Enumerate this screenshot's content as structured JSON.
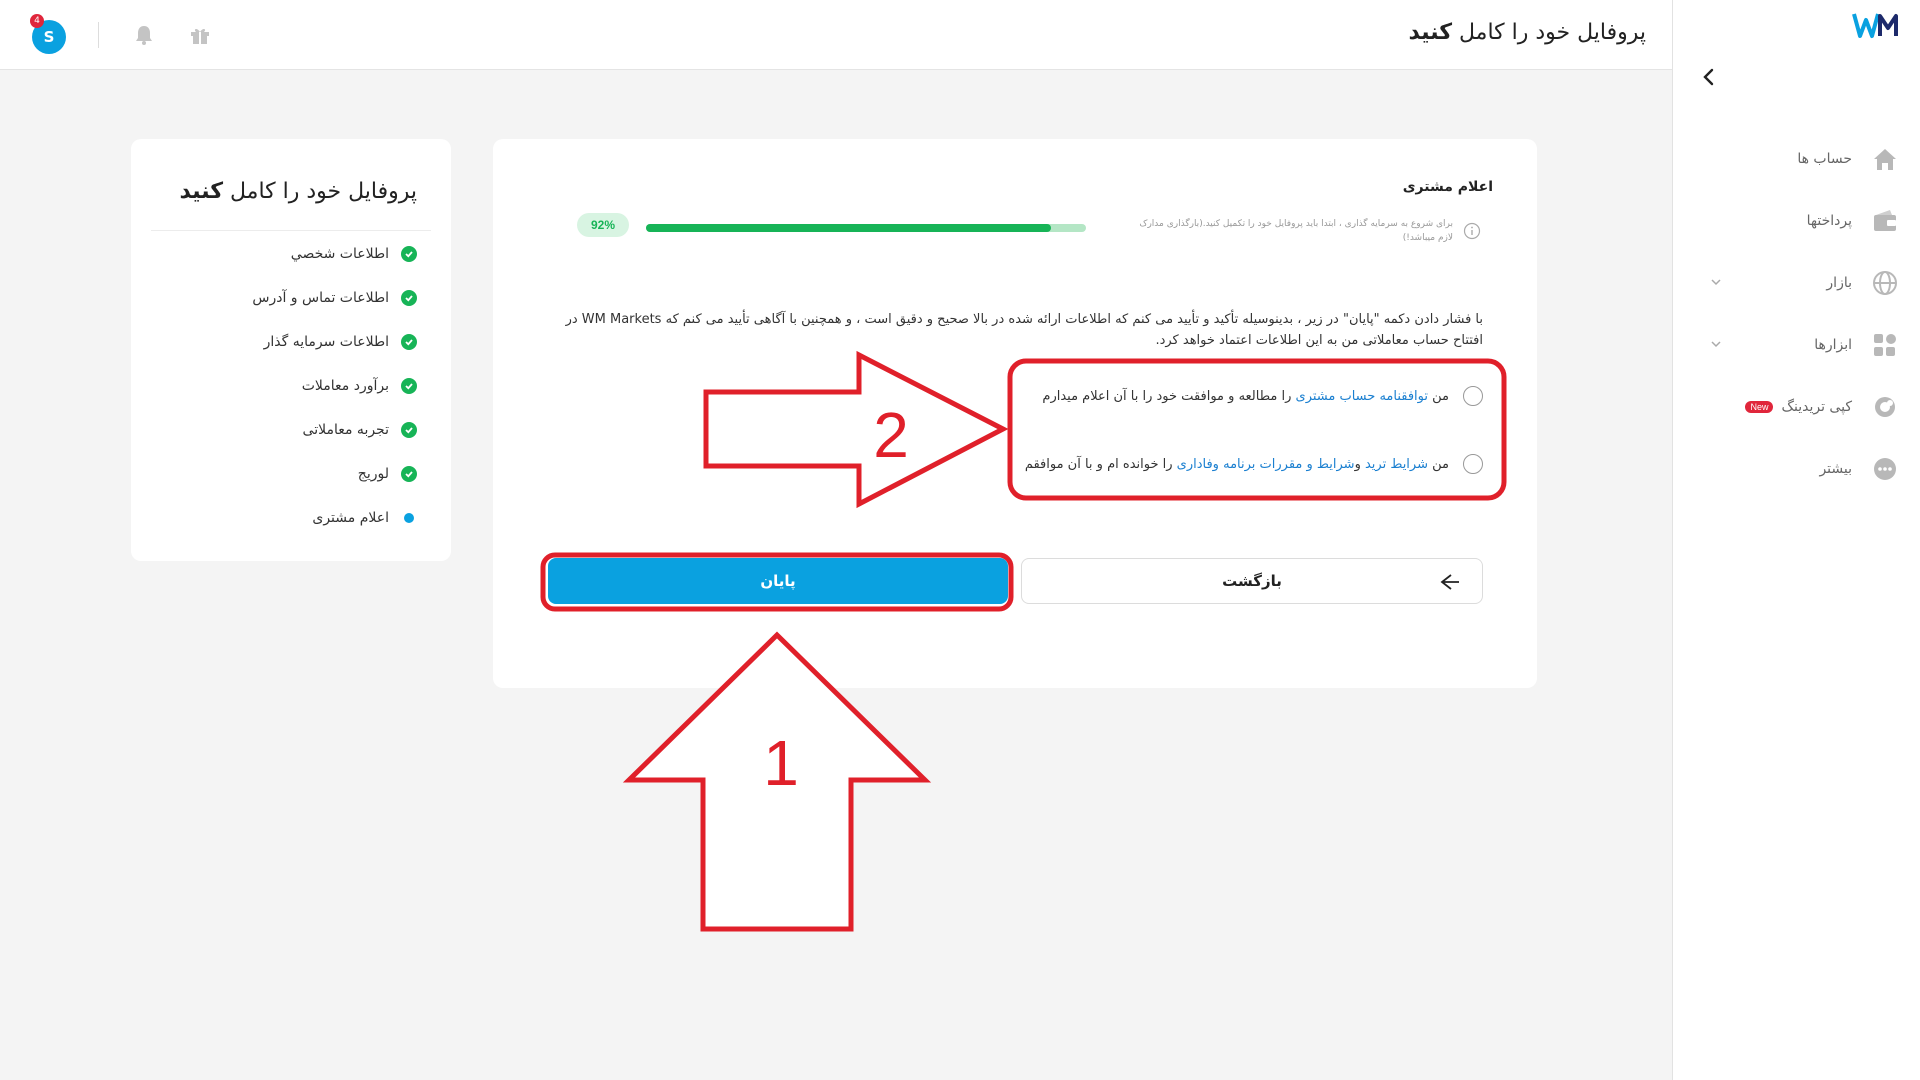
{
  "header": {
    "title_regular": "پروفایل خود را کامل ",
    "title_bold": "کنید",
    "avatar_letter": "S",
    "notification_count": "4"
  },
  "sidebar": {
    "items": [
      {
        "label": "حساب ها",
        "icon": "home-icon"
      },
      {
        "label": "پرداختها",
        "icon": "wallet-icon"
      },
      {
        "label": "بازار",
        "icon": "globe-icon"
      },
      {
        "label": "ابزارها",
        "icon": "tools-icon"
      },
      {
        "label": "کپی تریدینگ",
        "icon": "copy-trading-icon",
        "badge": "New"
      },
      {
        "label": "بیشتر",
        "icon": "more-icon"
      }
    ]
  },
  "steps": {
    "title_regular": "پروفایل خود را کامل ",
    "title_bold": "کنید",
    "items": [
      {
        "label": "اطلاعات شخصي",
        "status": "done"
      },
      {
        "label": "اطلاعات تماس و آدرس",
        "status": "done"
      },
      {
        "label": "اطلاعات سرمایه گذار",
        "status": "done"
      },
      {
        "label": "برآورد معاملات",
        "status": "done"
      },
      {
        "label": "تجربه معاملاتی",
        "status": "done"
      },
      {
        "label": "لوریج",
        "status": "done"
      },
      {
        "label": "اعلام مشتری",
        "status": "current"
      }
    ]
  },
  "main": {
    "section_title": "اعلام مشتری",
    "info_text": "برای شروع به سرمایه گذاری ، ابتدا باید پروفایل خود را تکمیل کنید.(بارگذاری مدارک لازم میباشد!)",
    "progress": 0.92,
    "progress_label": "92%",
    "description": "با فشار دادن دکمه \"پایان\" در زیر ، بدینوسیله تأکید و تأیید می کنم که اطلاعات ارائه شده در بالا صحیح و دقیق است ، و همچنین با آگاهی تأیید می کنم که WM Markets در افتتاح حساب معاملاتی من به این اطلاعات اعتماد خواهد کرد.",
    "option1": {
      "prefix": "من ",
      "link": "توافقنامه حساب مشتری",
      "suffix": " را مطالعه و موافقت خود را با آن اعلام میدارم"
    },
    "option2": {
      "prefix": "من ",
      "link1": "شرایط ترید",
      "mid": " و",
      "link2": "شرایط و مقررات برنامه وفاداری",
      "suffix": " را خوانده ام و با آن موافقم"
    },
    "finish_label": "پایان",
    "back_label": "بازگشت"
  },
  "annotations": {
    "arrow1_label": "1",
    "arrow2_label": "2",
    "color": "#e0202a"
  }
}
